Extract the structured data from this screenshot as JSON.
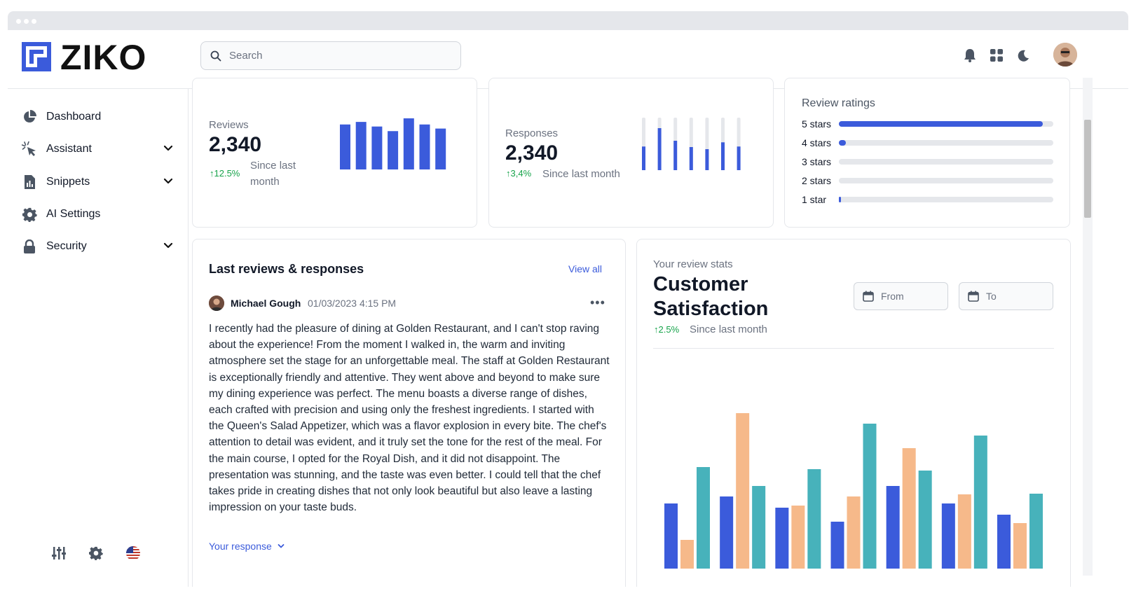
{
  "app": {
    "name": "ZIKO"
  },
  "search": {
    "placeholder": "Search"
  },
  "header_icons": [
    "bell-icon",
    "apps-grid-icon",
    "moon-icon"
  ],
  "sidebar": {
    "items": [
      {
        "label": "Dashboard",
        "icon": "pie-chart-icon",
        "expandable": false
      },
      {
        "label": "Assistant",
        "icon": "cursor-click-icon",
        "expandable": true
      },
      {
        "label": "Snippets",
        "icon": "document-chart-icon",
        "expandable": true
      },
      {
        "label": "AI Settings",
        "icon": "gear-icon",
        "expandable": false
      },
      {
        "label": "Security",
        "icon": "lock-icon",
        "expandable": true
      }
    ],
    "bottom_icons": [
      "sliders-icon",
      "gear-icon",
      "us-flag-icon"
    ]
  },
  "stats": {
    "reviews": {
      "label": "Reviews",
      "value": "2,340",
      "trend": "12.5%",
      "since": "Since last month"
    },
    "responses": {
      "label": "Responses",
      "value": "2,340",
      "trend": "3,4%",
      "since": "Since last month"
    }
  },
  "ratings": {
    "title": "Review ratings",
    "rows": [
      {
        "label": "5 stars",
        "fraction": 0.95
      },
      {
        "label": "4 stars",
        "fraction": 0.03
      },
      {
        "label": "3 stars",
        "fraction": 0.0
      },
      {
        "label": "2 stars",
        "fraction": 0.0
      },
      {
        "label": "1 star",
        "fraction": 0.01
      }
    ]
  },
  "reviews_card": {
    "title": "Last reviews & responses",
    "view_all": "View all",
    "author": "Michael Gough",
    "date": "01/03/2023 4:15 PM",
    "text": "I recently had the pleasure of dining at Golden Restaurant, and I can't stop raving about the experience! From the moment I walked in, the warm and inviting atmosphere set the stage for an unforgettable meal. The staff at Golden Restaurant is exceptionally friendly and attentive. They went above and beyond to make sure my dining experience was perfect. The menu boasts a diverse range of dishes, each crafted with precision and using only the freshest ingredients. I started with the Queen's Salad Appetizer, which was a flavor explosion in every bite. The chef's attention to detail was evident, and it truly set the tone for the rest of the meal. For the main course, I opted for the Royal Dish, and it did not disappoint. The presentation was stunning, and the taste was even better. I could tell that the chef takes pride in creating dishes that not only look beautiful but also leave a lasting impression on your taste buds.",
    "your_response": "Your response"
  },
  "satisfaction": {
    "subtitle": "Your review stats",
    "title_line1": "Customer",
    "title_line2": "Satisfaction",
    "trend": "2.5%",
    "since": "Since last month",
    "from_label": "From",
    "to_label": "To"
  },
  "chart_data": [
    {
      "type": "bar",
      "chart": "reviews-mini",
      "values": [
        0.88,
        0.93,
        0.84,
        0.75,
        1.0,
        0.88,
        0.8
      ],
      "color": "#3b5bdb"
    },
    {
      "type": "bar",
      "chart": "responses-mini",
      "values": [
        0.45,
        0.8,
        0.56,
        0.44,
        0.4,
        0.53,
        0.45
      ],
      "color": "#3b5bdb",
      "track_color": "#e5e7eb"
    },
    {
      "type": "bar",
      "chart": "customer-satisfaction",
      "series": [
        {
          "values": [
            93,
            103,
            87,
            67,
            118,
            93,
            77
          ],
          "color": "#3b5bdb"
        },
        {
          "values": [
            41,
            222,
            90,
            103,
            172,
            106,
            65
          ],
          "color": "#f6b98a"
        },
        {
          "values": [
            145,
            118,
            142,
            207,
            140,
            190,
            107
          ],
          "color": "#47b2bb"
        }
      ],
      "ylim": [
        0,
        240
      ]
    }
  ],
  "colors": {
    "accent": "#3b5bdb",
    "positive": "#16a34a",
    "orange": "#f6b98a",
    "teal": "#47b2bb"
  }
}
